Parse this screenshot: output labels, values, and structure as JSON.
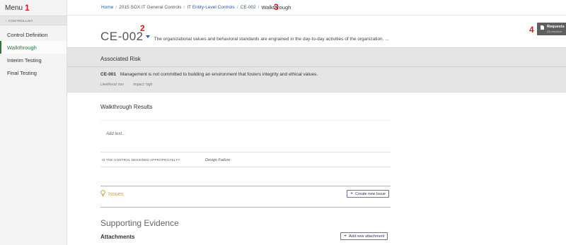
{
  "sidebar": {
    "menu_label": "Menu",
    "marker": "1",
    "controllist_label": "CONTROLLIST",
    "items": [
      {
        "label": "Control Definition",
        "active": false
      },
      {
        "label": "Walkthrough",
        "active": true
      },
      {
        "label": "Interim Testing",
        "active": false
      },
      {
        "label": "Final Testing",
        "active": false
      }
    ]
  },
  "breadcrumb": {
    "items": [
      {
        "label": "Home",
        "link": true
      },
      {
        "label": "2015 SOX IT General Controls",
        "link": false
      },
      {
        "label": "IT Entity-Level Controls",
        "link": true
      },
      {
        "label": "CE-002",
        "link": true
      }
    ],
    "current": "Walkthrough",
    "marker": "3"
  },
  "control": {
    "id": "CE-002",
    "marker": "2",
    "description": "The organizational values and behavioral standards are engrained in the day-to-day activities of the organization. ..."
  },
  "requests": {
    "label": "Requests",
    "sub": "(0) resolved",
    "marker": "4"
  },
  "risk": {
    "header": "Associated Risk",
    "id": "CE-001",
    "text": "Management is not committed to building an environment that fosters integrity and ethical values.",
    "likelihood": "Likelihood: low",
    "impact": "Impact: high"
  },
  "walkthrough": {
    "title": "Walkthrough Results",
    "placeholder": "Add text...",
    "question": "IS THE CONTROL DESIGNED APPROPRIATELY?",
    "answer": "Design Failure"
  },
  "issues": {
    "label": "Issues",
    "create_button": "Create new Issue"
  },
  "evidence": {
    "title": "Supporting Evidence",
    "attachments_title": "Attachments",
    "add_button": "Add new attachment"
  },
  "colors": {
    "accent_green": "#2d7a3e",
    "link_blue": "#2a5d9f",
    "issues_amber": "#d89a2a",
    "marker_red": "#cc1f1f"
  }
}
